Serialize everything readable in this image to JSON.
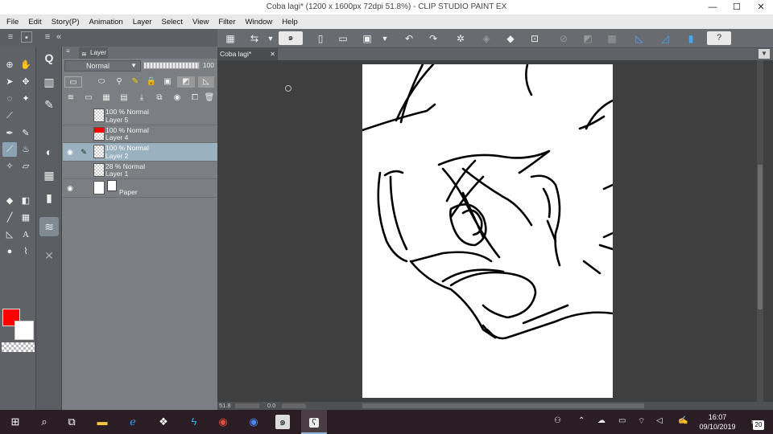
{
  "window": {
    "title": "Coba lagi* (1200 x 1600px 72dpi 51.8%)  - CLIP STUDIO PAINT EX",
    "minimize": "—",
    "maximize": "☐",
    "close": "✕"
  },
  "menu": [
    "File",
    "Edit",
    "Story(P)",
    "Animation",
    "Layer",
    "Select",
    "View",
    "Filter",
    "Window",
    "Help"
  ],
  "layer_panel": {
    "tab_label": "Layer",
    "blend_mode": "Normal",
    "opacity": "100",
    "layers": [
      {
        "opacity_mode": "100 % Normal",
        "name": "Layer 5"
      },
      {
        "opacity_mode": "100 % Normal",
        "name": "Layer 4"
      },
      {
        "opacity_mode": "100 % Normal",
        "name": "Layer 2"
      },
      {
        "opacity_mode": "28 % Normal",
        "name": "Layer 1"
      },
      {
        "name": "Paper"
      }
    ]
  },
  "document": {
    "tab_label": "Coba lagi*",
    "zoom": "51.8",
    "rotation": "0.0"
  },
  "colors": {
    "main": "#ff0000",
    "sub": "#ffffff"
  },
  "taskbar": {
    "time": "16:07",
    "date": "09/10/2019",
    "notification_count": "20"
  }
}
